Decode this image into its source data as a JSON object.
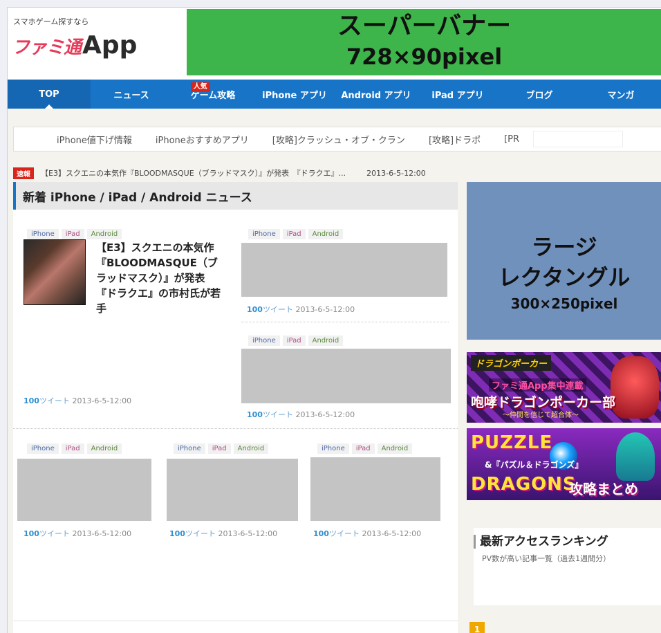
{
  "header": {
    "tagline": "スマホゲーム探すなら",
    "logo_mark": "ファミ通",
    "logo_app": "App",
    "superbanner_line1": "スーパーバナー",
    "superbanner_line2": "728×90pixel"
  },
  "gnav": {
    "items": [
      "TOP",
      "ニュース",
      "ゲーム攻略",
      "iPhone アプリ",
      "Android アプリ",
      "iPad アプリ",
      "ブログ",
      "マンガ"
    ],
    "popular_badge": "人気"
  },
  "subnav": {
    "items": [
      "iPhone値下げ情報",
      "iPhoneおすすめアプリ",
      "[攻略]クラッシュ・オブ・クラン",
      "[攻略]ドラポ",
      "[PR"
    ]
  },
  "breaking": {
    "badge": "速報",
    "text": "【E3】スクエニの本気作『BLOODMASQUE（ブラッドマスク）』が発表　『ドラクエ』...",
    "date": "2013-6-5-12:00"
  },
  "main": {
    "section_title": "新着 iPhone / iPad / Android ニュース",
    "tags": {
      "iphone": "iPhone",
      "ipad": "iPad",
      "android": "Android"
    },
    "featured": {
      "title": "【E3】スクエニの本気作『BLOODMASQUE（ブラッドマスク）』が発表　『ドラクエ』の市村氏が若手",
      "tweets_count": "100",
      "tweets_label": "ツイート",
      "date": "2013-6-5-12:00"
    },
    "articles": [
      {
        "tweets_count": "100",
        "tweets_label": "ツイート",
        "date": "2013-6-5-12:00"
      },
      {
        "tweets_count": "100",
        "tweets_label": "ツイート",
        "date": "2013-6-5-12:00"
      },
      {
        "tweets_count": "100",
        "tweets_label": "ツイート",
        "date": "2013-6-5-12:00"
      },
      {
        "tweets_count": "100",
        "tweets_label": "ツイート",
        "date": "2013-6-5-12:00"
      },
      {
        "tweets_count": "100",
        "tweets_label": "ツイート",
        "date": "2013-6-5-12:00"
      }
    ]
  },
  "sidebar": {
    "rect_ad_line1": "ラージ",
    "rect_ad_line2": "レクタングル",
    "rect_ad_line3": "300×250pixel",
    "banner1": {
      "logo": "ドラゴンポーカー",
      "line1": "ファミ通App集中連載",
      "line2": "咆哮ドラゴンポーカー部",
      "line3": "～仲間を信じて超合体～"
    },
    "banner2": {
      "line1": "PUZZLE",
      "line2": "&『パズル＆ドラゴンズ』",
      "line3": "DRAGONS",
      "line4": "攻略まとめ"
    },
    "ranking_title": "最新アクセスランキング",
    "ranking_sub": "PV数が高い記事一覧（過去1週間分）",
    "rank_first": "1"
  },
  "colors": {
    "nav_blue": "#1874c7",
    "superbanner_green": "#3db54a",
    "rect_ad_blue": "#7191bd",
    "placeholder_gray": "#c4c4c4",
    "breaking_red": "#d8261b",
    "tweet_blue": "#2f8fd3"
  }
}
